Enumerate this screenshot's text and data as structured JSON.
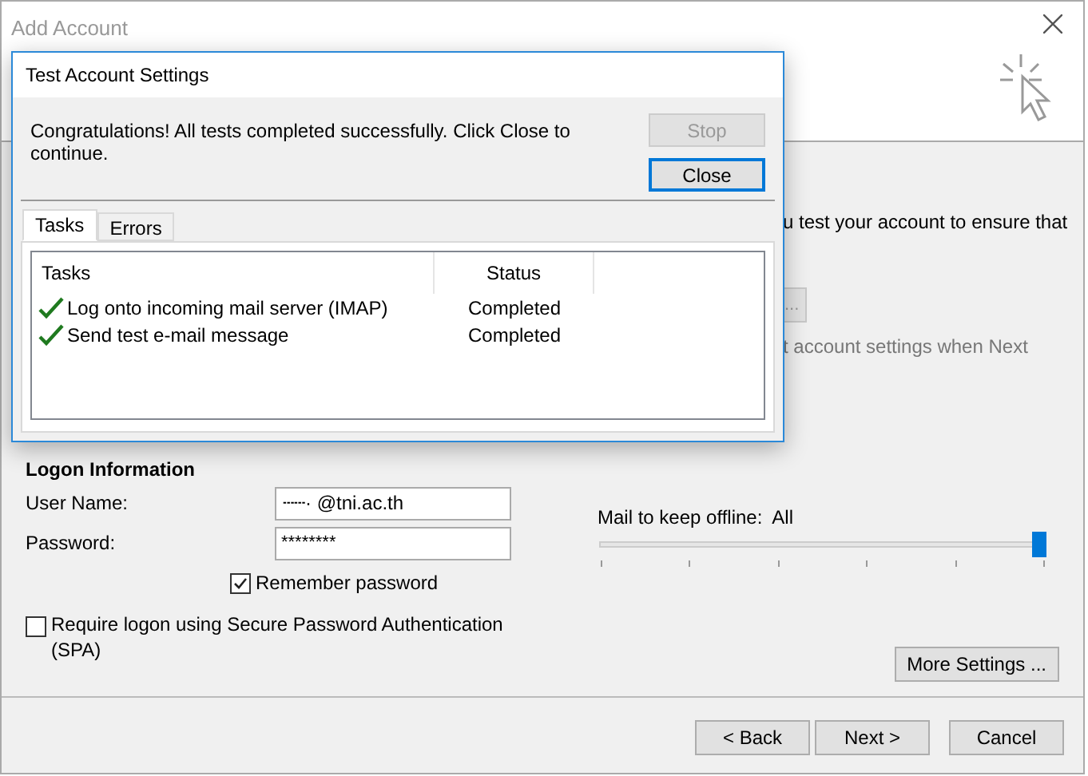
{
  "window": {
    "title": "Add Account"
  },
  "background_fragments": [
    {
      "text": "u test your account to ensure that",
      "kind": "text"
    },
    {
      "text": "...",
      "kind": "button"
    },
    {
      "text": "t account settings when Next",
      "kind": "muted"
    }
  ],
  "logon": {
    "heading": "Logon Information",
    "user_name": {
      "label": "User Name:",
      "value": "┄┄· @tni.ac.th"
    },
    "password": {
      "label": "Password:",
      "value": "********"
    },
    "remember": {
      "label": "Remember password",
      "checked": true
    },
    "spa": {
      "label": "Require logon using Secure Password Authentication (SPA)",
      "checked": false
    }
  },
  "offline": {
    "label": "Mail to keep offline:",
    "value": "All",
    "level": 1
  },
  "more_settings": "More Settings ...",
  "buttons": [
    "< Back",
    "Next >",
    "Cancel"
  ],
  "dialog": {
    "title": "Test Account Settings",
    "message": "Congratulations! All tests completed successfully. Click Close to continue.",
    "buttons": [
      {
        "label": "Stop",
        "disabled": true,
        "default": false
      },
      {
        "label": "Close",
        "disabled": false,
        "default": true
      }
    ],
    "tabs": [
      {
        "label": "Tasks",
        "selected": true
      },
      {
        "label": "Errors",
        "selected": false
      }
    ],
    "columns": [
      "Tasks",
      "Status"
    ],
    "rows": [
      {
        "task": "Log onto incoming mail server (IMAP)",
        "status": "Completed",
        "done": true
      },
      {
        "task": "Send test e-mail message",
        "status": "Completed",
        "done": true
      }
    ]
  }
}
